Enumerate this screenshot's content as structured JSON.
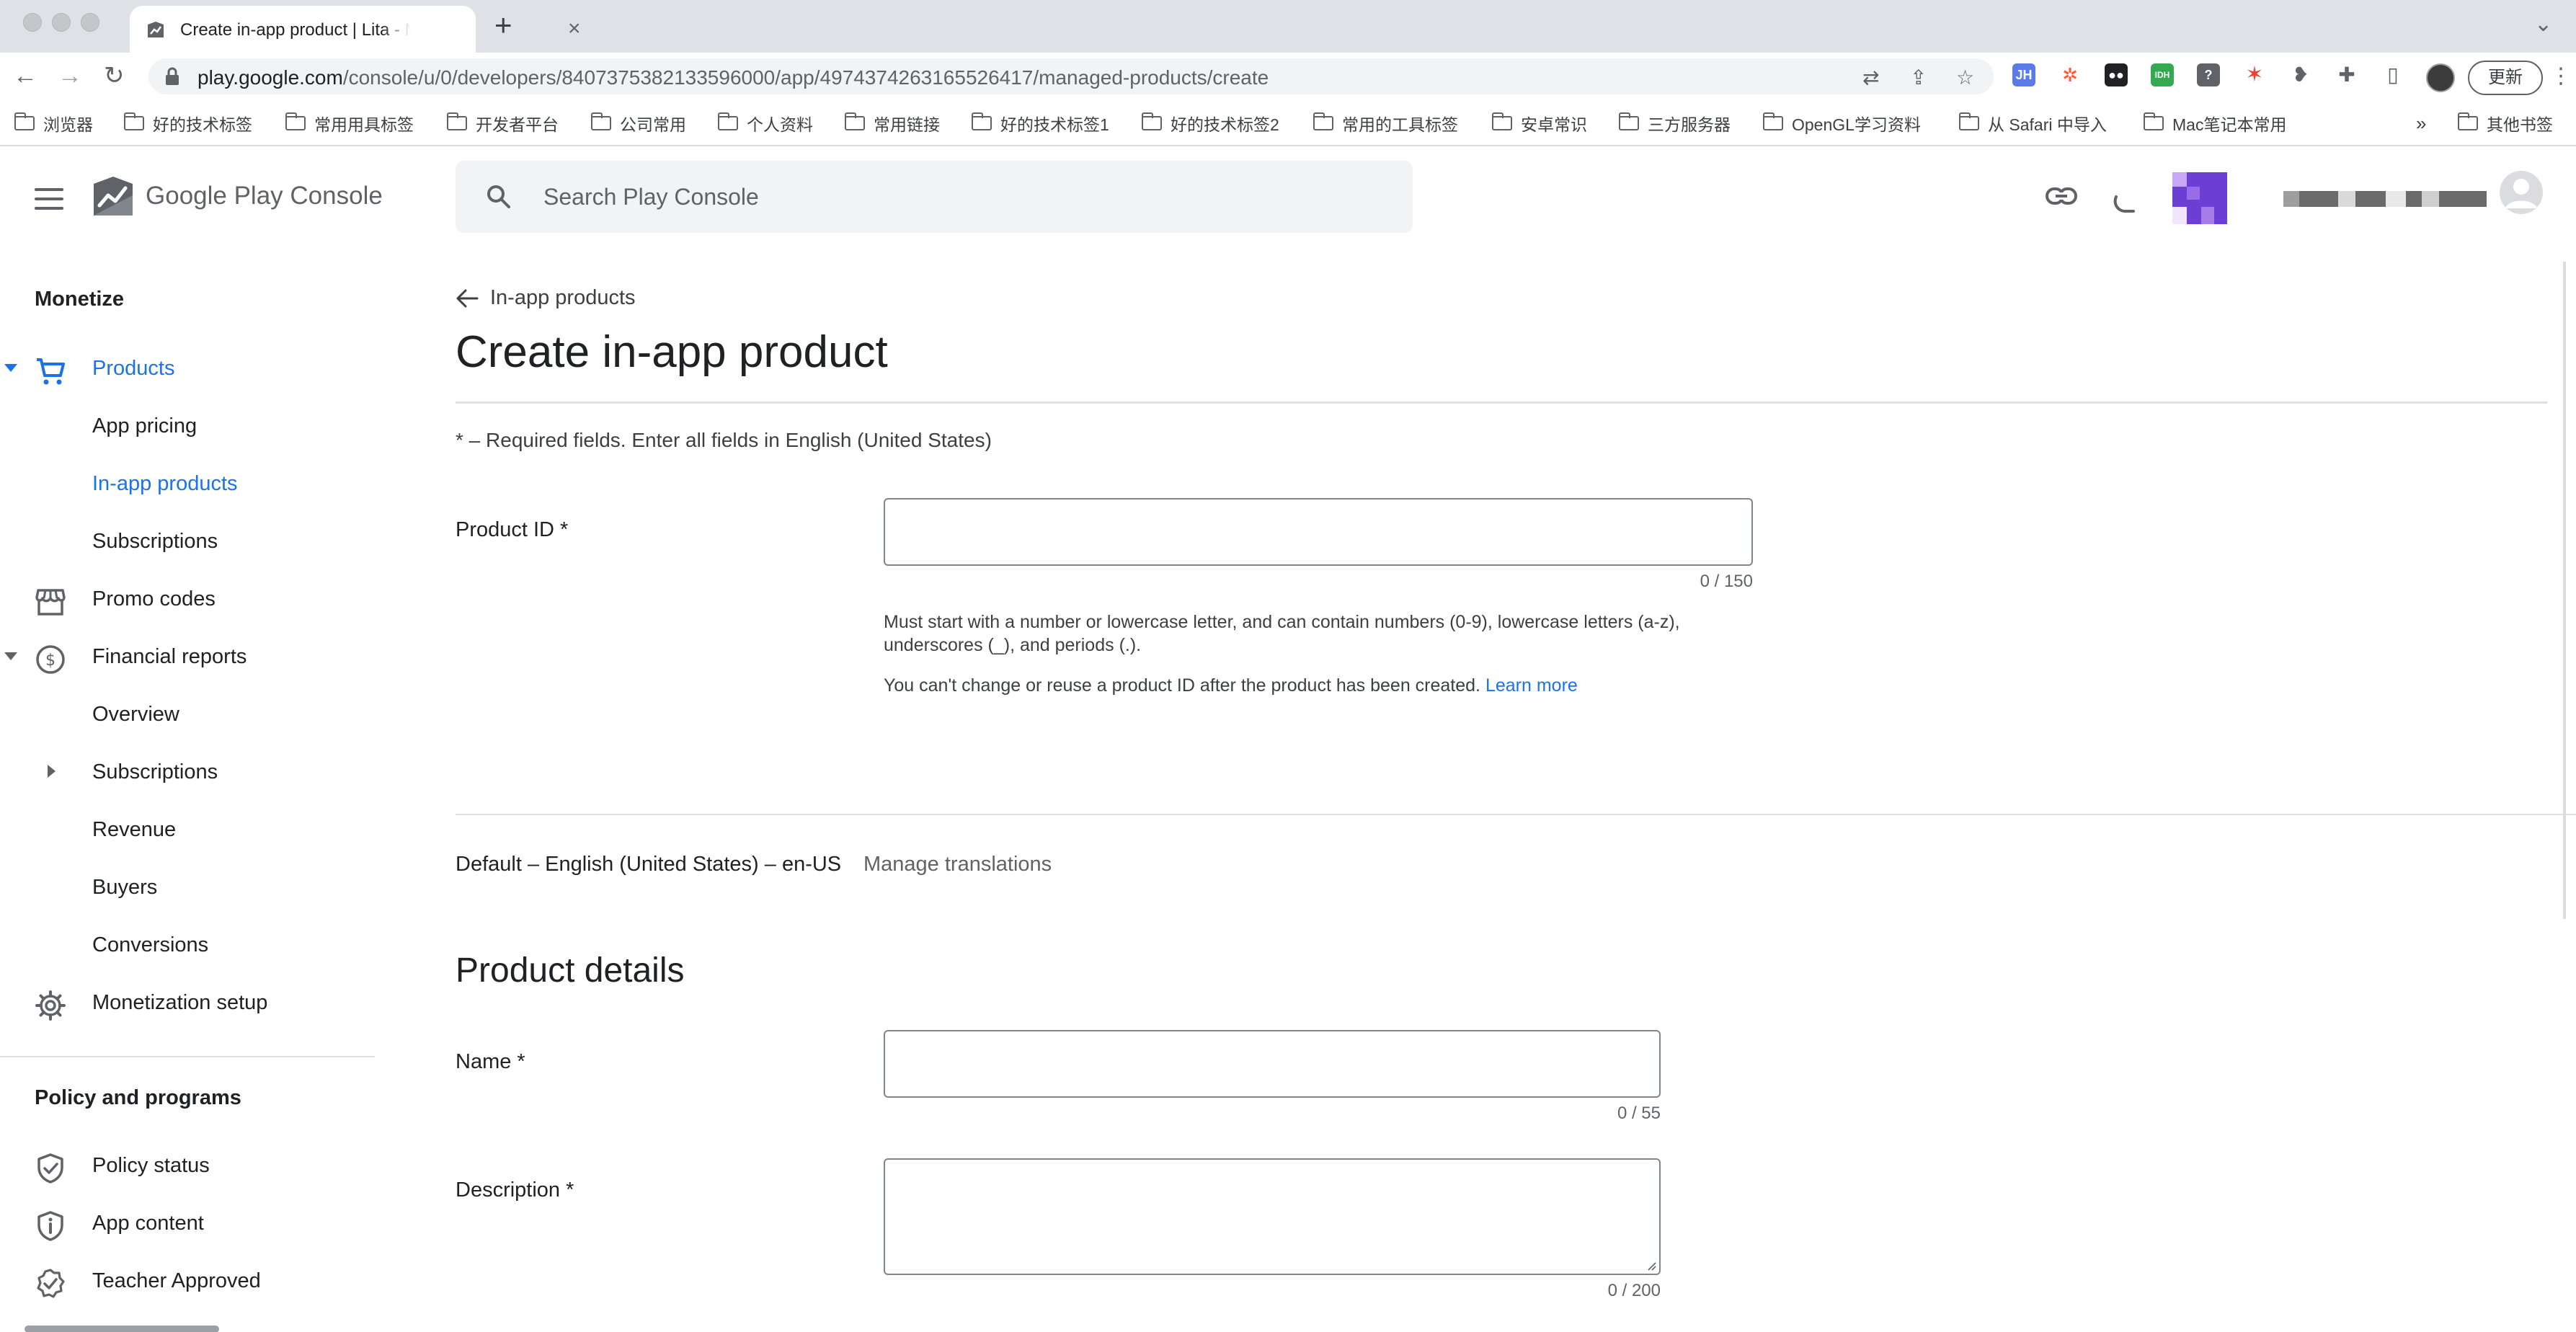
{
  "browser": {
    "tab_title": "Create in-app product | Lita - M",
    "url_host": "play.google.com",
    "url_path": "/console/u/0/developers/8407375382133596000/app/4974374263165526417/managed-products/create",
    "update_label": "更新",
    "extensions": [
      {
        "name": "jh-extension-icon",
        "text": "JH",
        "color": "#5b7be6"
      },
      {
        "name": "pinwheel-extension-icon",
        "text": "",
        "color": "#ff5a36"
      },
      {
        "name": "tampermonkey-extension-icon",
        "text": "",
        "color": "#202124"
      },
      {
        "name": "green-extension-icon",
        "text": "",
        "color": "#34a853"
      },
      {
        "name": "shield-extension-icon",
        "text": "",
        "color": "#5f6368"
      },
      {
        "name": "star-extension-icon",
        "text": "",
        "color": "#ea4335"
      },
      {
        "name": "bear-extension-icon",
        "text": "",
        "color": "#5f6368"
      }
    ],
    "bookmarks": [
      {
        "label": "浏览器"
      },
      {
        "label": "好的技术标签"
      },
      {
        "label": "常用用具标签"
      },
      {
        "label": "开发者平台"
      },
      {
        "label": "公司常用"
      },
      {
        "label": "个人资料"
      },
      {
        "label": "常用链接"
      },
      {
        "label": "好的技术标签1"
      },
      {
        "label": "好的技术标签2"
      },
      {
        "label": "常用的工具标签"
      },
      {
        "label": "安卓常识"
      },
      {
        "label": "三方服务器"
      },
      {
        "label": "OpenGL学习资料"
      },
      {
        "label": "从 Safari 中导入"
      },
      {
        "label": "Mac笔记本常用"
      }
    ],
    "bookmarks_more": "»",
    "other_bookmarks": "其他书签"
  },
  "header": {
    "logo_text_main": "Google Play",
    "logo_text_sub": "Console",
    "search_placeholder": "Search Play Console"
  },
  "sidebar": {
    "section_monetize": "Monetize",
    "items": [
      {
        "label": "Products"
      },
      {
        "label": "App pricing"
      },
      {
        "label": "In-app products"
      },
      {
        "label": "Subscriptions"
      },
      {
        "label": "Promo codes"
      },
      {
        "label": "Financial reports"
      },
      {
        "label": "Overview"
      },
      {
        "label": "Subscriptions"
      },
      {
        "label": "Revenue"
      },
      {
        "label": "Buyers"
      },
      {
        "label": "Conversions"
      },
      {
        "label": "Monetization setup"
      }
    ],
    "section_policy": "Policy and programs",
    "policy_items": [
      {
        "label": "Policy status"
      },
      {
        "label": "App content"
      },
      {
        "label": "Teacher Approved"
      }
    ]
  },
  "main": {
    "back_label": "In-app products",
    "title": "Create in-app product",
    "required_hint": "* – Required fields. Enter all fields in English (United States)",
    "product_id": {
      "label": "Product ID  *",
      "value": "",
      "counter": "0 / 150",
      "help_line1": "Must start with a number or lowercase letter, and can contain numbers (0-9), lowercase letters (a-z),",
      "help_line2": "underscores (_), and periods (.).",
      "help_line3": "You can't change or reuse a product ID after the product has been created.",
      "learn_more": "Learn more"
    },
    "language_default": "Default – English (United States) – en-US",
    "manage_translations": "Manage translations",
    "product_details_title": "Product details",
    "name": {
      "label": "Name  *",
      "value": "",
      "counter": "0 / 55"
    },
    "description": {
      "label": "Description  *",
      "value": "",
      "counter": "0 / 200"
    }
  },
  "colors": {
    "accent": "#1a73e8",
    "text": "#202124",
    "muted": "#5f6368"
  }
}
